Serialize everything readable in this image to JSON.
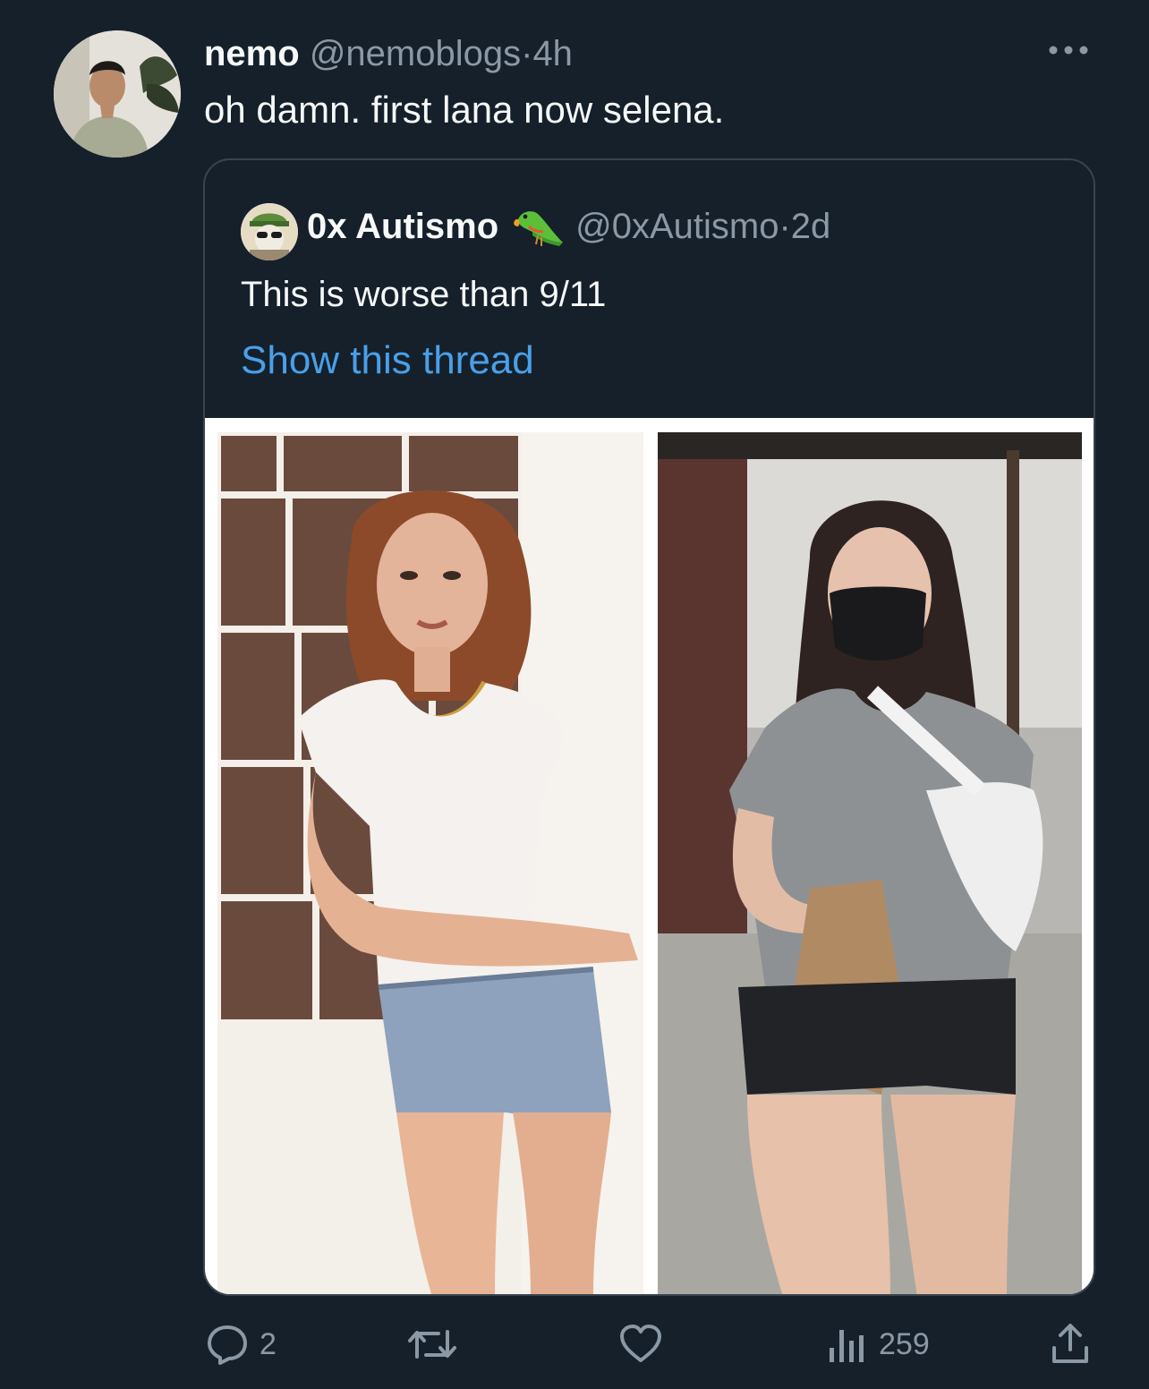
{
  "author": {
    "display_name": "nemo",
    "handle": "@nemoblogs",
    "separator": "·",
    "time": "4h",
    "avatar_icon": "user-avatar"
  },
  "tweet": {
    "text": "oh damn. first lana now selena."
  },
  "more_icon": "more-horizontal-icon",
  "quoted": {
    "display_name": "0x Autismo",
    "badge_icon": "parrot-emoji-icon",
    "handle": "@0xAutismo",
    "separator": "·",
    "time": "2d",
    "text": "This is worse than 9/11",
    "show_thread": "Show this thread",
    "media": [
      {
        "icon": "photo-woman-white-tee-denim-shorts"
      },
      {
        "icon": "photo-woman-face-mask-gray-tee-arm-sling"
      }
    ]
  },
  "actions": {
    "reply_count": "2",
    "retweet_count": "",
    "like_count": "",
    "views_count": "259"
  },
  "colors": {
    "background": "#15202b",
    "text_primary": "#f7f9f9",
    "text_secondary": "#8b98a5",
    "link": "#4a9fe8",
    "border": "#38444d"
  }
}
